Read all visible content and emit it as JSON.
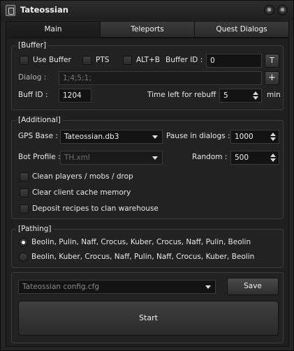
{
  "window": {
    "title": "Tateossian"
  },
  "tabs": [
    {
      "label": "Main",
      "active": true
    },
    {
      "label": "Teleports",
      "active": false
    },
    {
      "label": "Quest Dialogs",
      "active": false
    }
  ],
  "buffer": {
    "legend": "[Buffer]",
    "use_buffer_label": "Use Buffer",
    "use_buffer_checked": false,
    "pts_label": "PTS",
    "pts_checked": false,
    "alt_b_label": "ALT+B",
    "alt_b_checked": false,
    "buffer_id_label": "Buffer ID :",
    "buffer_id_value": "0",
    "t_button": "T",
    "dialog_label": "Dialog :",
    "dialog_value": "1;4;5;1;",
    "plus_button": "+",
    "buff_id_label": "Buff ID :",
    "buff_id_value": "1204",
    "time_left_label": "Time left for rebuff :",
    "time_left_value": "5",
    "time_unit": "min"
  },
  "additional": {
    "legend": "[Additional]",
    "gps_base_label": "GPS Base :",
    "gps_base_value": "Tateossian.db3",
    "pause_label": "Pause in dialogs :",
    "pause_value": "1000",
    "bot_profile_label": "Bot Profile :",
    "bot_profile_value": "TH.xml",
    "random_label": "Random :",
    "random_value": "500",
    "checkboxes": [
      {
        "label": "Clean players / mobs / drop",
        "checked": false
      },
      {
        "label": "Clear client cache memory",
        "checked": false
      },
      {
        "label": "Deposit recipes to clan warehouse",
        "checked": false
      }
    ]
  },
  "pathing": {
    "legend": "[Pathing]",
    "options": [
      {
        "label": "Beolin, Pulin, Naff, Crocus, Kuber, Crocus, Naff, Pulin, Beolin",
        "checked": true
      },
      {
        "label": "Beolin, Kuber, Crocus, Naff, Pulin, Naff, Crocus, Kuber, Beolin",
        "checked": false
      }
    ]
  },
  "footer": {
    "config_value": "Tateossian config.cfg",
    "save_label": "Save",
    "start_label": "Start"
  }
}
